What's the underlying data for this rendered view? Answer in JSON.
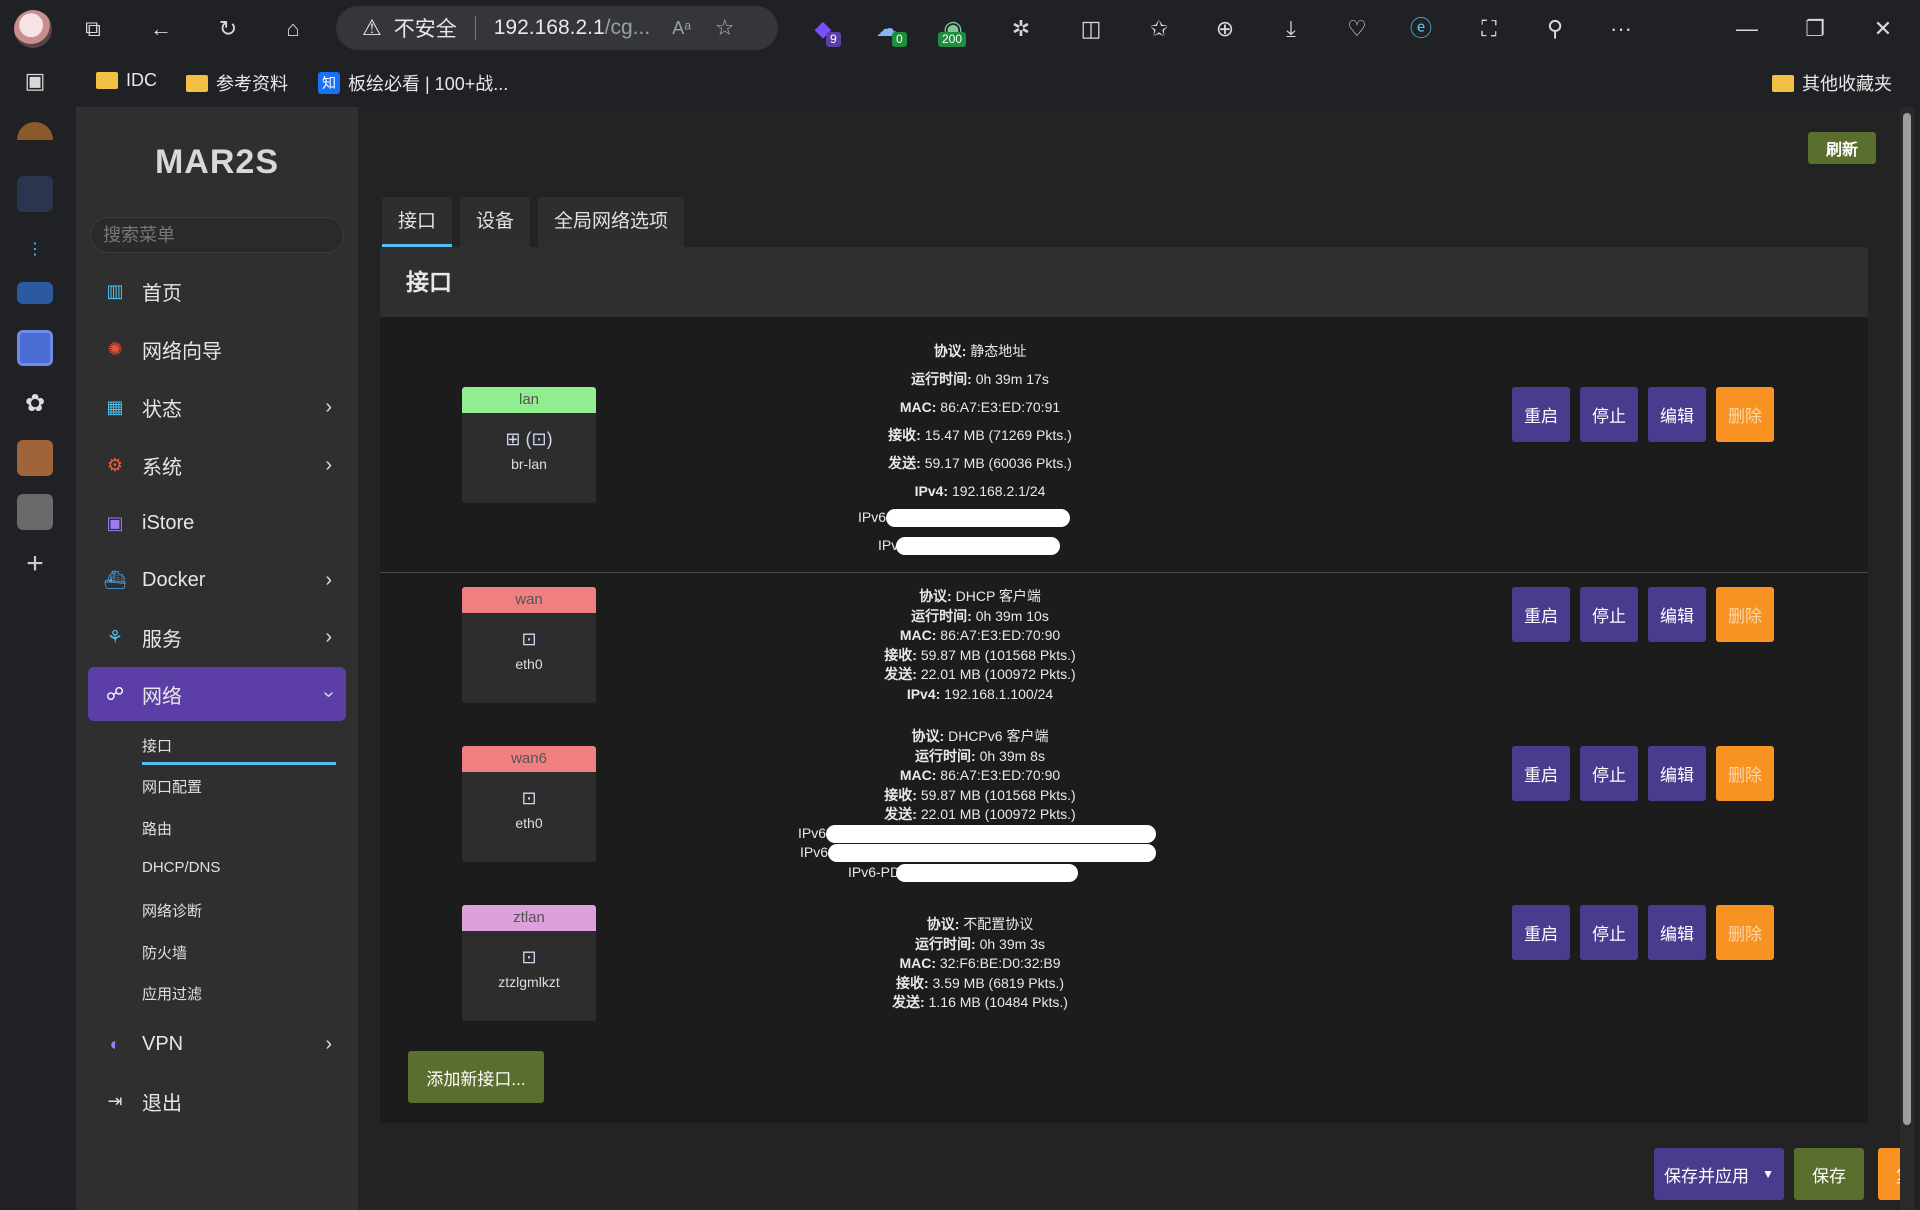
{
  "browser": {
    "insecure_label": "不安全",
    "url": "192.168.2.1",
    "url_rest": "/cg...",
    "reader_label": "Aᵃ",
    "ext_badges": [
      "9",
      "0",
      "200"
    ],
    "more_label": "···",
    "bookmarks": [
      {
        "label": "IDC",
        "icon": "folder-icon"
      },
      {
        "label": "参考资料",
        "icon": "folder-icon"
      },
      {
        "label": "板绘必看 | 100+战...",
        "icon": "zhihu-icon",
        "icon_text": "知"
      }
    ],
    "other_bookmarks": "其他收藏夹"
  },
  "sidebar": {
    "logo": "MAR2S",
    "search_placeholder": "搜索菜单",
    "items": [
      {
        "label": "首页",
        "icon": "dashboard-icon"
      },
      {
        "label": "网络向导",
        "icon": "wizard-icon"
      },
      {
        "label": "状态",
        "icon": "status-icon",
        "has_chevron": true
      },
      {
        "label": "系统",
        "icon": "gear-icon",
        "has_chevron": true
      },
      {
        "label": "iStore",
        "icon": "store-icon"
      },
      {
        "label": "Docker",
        "icon": "docker-icon",
        "has_chevron": true
      },
      {
        "label": "服务",
        "icon": "services-icon",
        "has_chevron": true
      },
      {
        "label": "网络",
        "icon": "network-icon",
        "has_chevron": true,
        "active": true
      },
      {
        "label": "VPN",
        "icon": "vpn-icon",
        "has_chevron": true
      },
      {
        "label": "退出",
        "icon": "logout-icon"
      }
    ],
    "sub_items": [
      "接口",
      "网口配置",
      "路由",
      "DHCP/DNS",
      "网络诊断",
      "防火墙",
      "应用过滤"
    ]
  },
  "main": {
    "refresh_button": "刷新",
    "tabs": [
      "接口",
      "设备",
      "全局网络选项"
    ],
    "panel_title": "接口",
    "action_labels": {
      "restart": "重启",
      "stop": "停止",
      "edit": "编辑",
      "delete": "删除"
    },
    "add_button": "添加新接口...",
    "footer": {
      "save_apply": "保存并应用",
      "save": "保存",
      "reset": "复位"
    },
    "interfaces": [
      {
        "name": "lan",
        "device": "br-lan",
        "header_color": "#90ee90",
        "lines": [
          {
            "k": "协议:",
            "v": "静态地址"
          },
          {
            "k": "运行时间:",
            "v": "0h 39m 17s"
          },
          {
            "k": "MAC:",
            "v": "86:A7:E3:ED:70:91"
          },
          {
            "k": "接收:",
            "v": "15.47 MB (71269 Pkts.)"
          },
          {
            "k": "发送:",
            "v": "59.17 MB (60036 Pkts.)"
          },
          {
            "k": "IPv4:",
            "v": "192.168.2.1/24"
          }
        ],
        "redacted_labels": [
          "IPv6",
          "IPv6"
        ]
      },
      {
        "name": "wan",
        "device": "eth0",
        "header_color": "#f08080",
        "lines": [
          {
            "k": "协议:",
            "v": "DHCP 客户端"
          },
          {
            "k": "运行时间:",
            "v": "0h 39m 10s"
          },
          {
            "k": "MAC:",
            "v": "86:A7:E3:ED:70:90"
          },
          {
            "k": "接收:",
            "v": "59.87 MB (101568 Pkts.)"
          },
          {
            "k": "发送:",
            "v": "22.01 MB (100972 Pkts.)"
          },
          {
            "k": "IPv4:",
            "v": "192.168.1.100/24"
          }
        ],
        "redacted_labels": []
      },
      {
        "name": "wan6",
        "device": "eth0",
        "header_color": "#f08080",
        "lines": [
          {
            "k": "协议:",
            "v": "DHCPv6 客户端"
          },
          {
            "k": "运行时间:",
            "v": "0h 39m 8s"
          },
          {
            "k": "MAC:",
            "v": "86:A7:E3:ED:70:90"
          },
          {
            "k": "接收:",
            "v": "59.87 MB (101568 Pkts.)"
          },
          {
            "k": "发送:",
            "v": "22.01 MB (100972 Pkts.)"
          }
        ],
        "redacted_labels": [
          "IPv6",
          "IPv6",
          "IPv6-PD"
        ]
      },
      {
        "name": "ztlan",
        "device": "ztzlgmlkzt",
        "header_color": "#dda0dd",
        "lines": [
          {
            "k": "协议:",
            "v": "不配置协议"
          },
          {
            "k": "运行时间:",
            "v": "0h 39m 3s"
          },
          {
            "k": "MAC:",
            "v": "32:F6:BE:D0:32:B9"
          },
          {
            "k": "接收:",
            "v": "3.59 MB (6819 Pkts.)"
          },
          {
            "k": "发送:",
            "v": "1.16 MB (10484 Pkts.)"
          }
        ],
        "redacted_labels": []
      }
    ]
  },
  "colors": {
    "accent": "#5b3fa6",
    "action_purple": "#4b3b8f",
    "delete_orange": "#f89321",
    "save_green": "#5a6e2d",
    "tab_underline": "#4fc1f0"
  }
}
